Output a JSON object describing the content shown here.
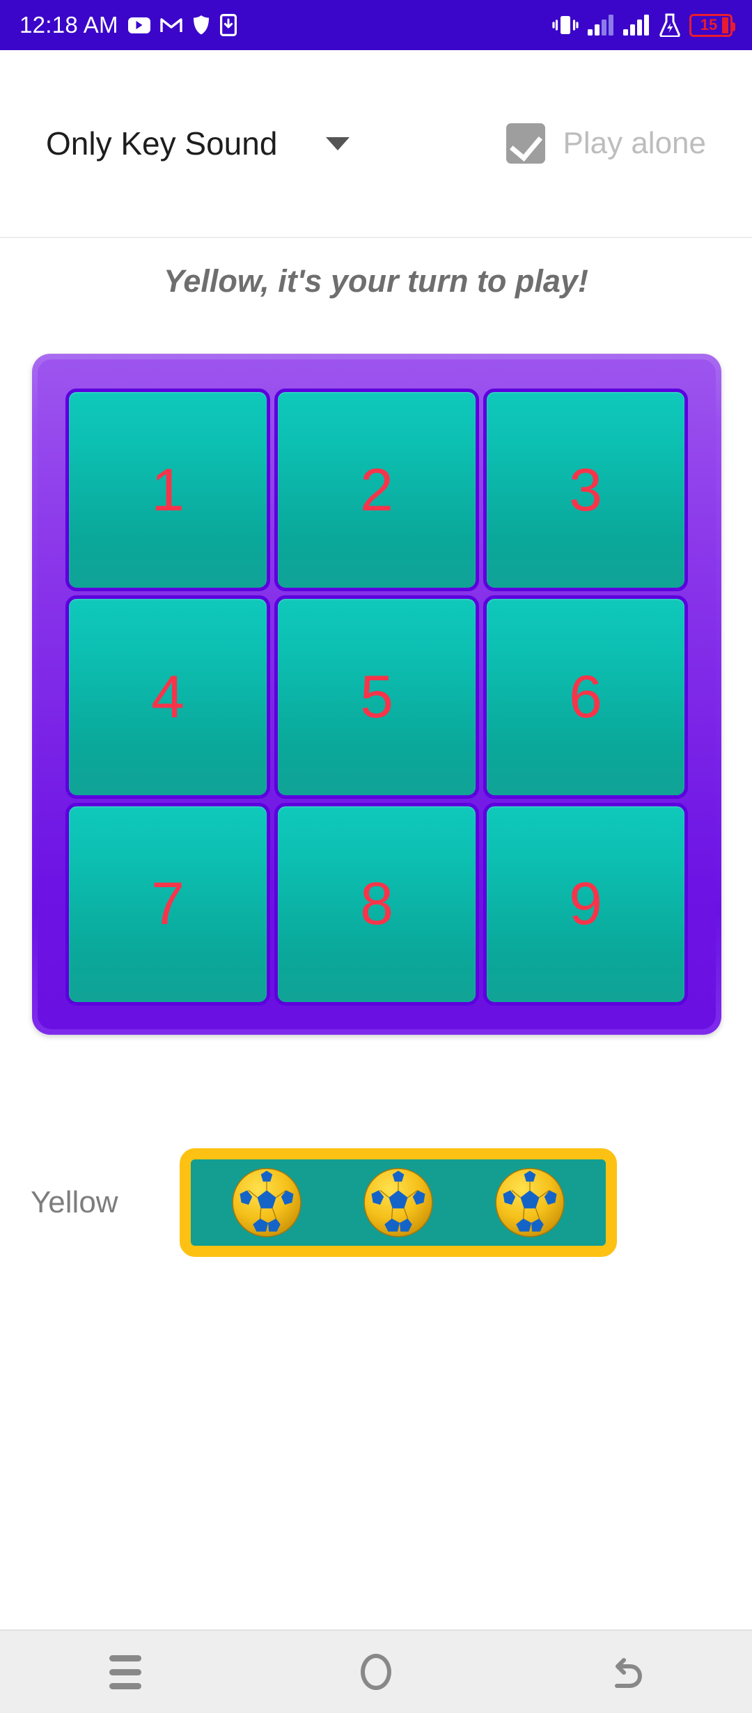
{
  "status_bar": {
    "time": "12:18 AM",
    "background_color": "#3b06c9",
    "left_icons": [
      "youtube-icon",
      "gmail-icon",
      "shield-icon",
      "download-icon"
    ],
    "right_icons": [
      "vibrate-icon",
      "signal-icon-1",
      "signal-icon-2",
      "battery-saver-icon"
    ],
    "battery_level": "15",
    "battery_color": "#e81c2e"
  },
  "toolbar": {
    "sound_mode": "Only Key Sound",
    "dropdown_icon": "chevron-down-icon",
    "play_alone_label": "Play alone",
    "play_alone_checked": true,
    "checkbox_color": "#9e9e9e"
  },
  "turn_message": "Yellow, it's your turn to play!",
  "board": {
    "rows": 3,
    "columns": 3,
    "frame_color": "#8631ec",
    "cell_color": "#0cbfb1",
    "cell_border_color": "#5c00dd",
    "number_color": "#f7344a",
    "cells": [
      {
        "label": "1"
      },
      {
        "label": "2"
      },
      {
        "label": "3"
      },
      {
        "label": "4"
      },
      {
        "label": "5"
      },
      {
        "label": "6"
      },
      {
        "label": "7"
      },
      {
        "label": "8"
      },
      {
        "label": "9"
      }
    ]
  },
  "score_row": {
    "player_name": "Yellow",
    "panel_background": "#139e91",
    "panel_border": "#fcc113",
    "token_icon": "soccer-ball-icon",
    "token_count": 3
  },
  "nav_bar": {
    "background_color": "#eeeeee",
    "items": [
      {
        "name": "recents-icon"
      },
      {
        "name": "home-icon"
      },
      {
        "name": "back-icon"
      }
    ]
  }
}
